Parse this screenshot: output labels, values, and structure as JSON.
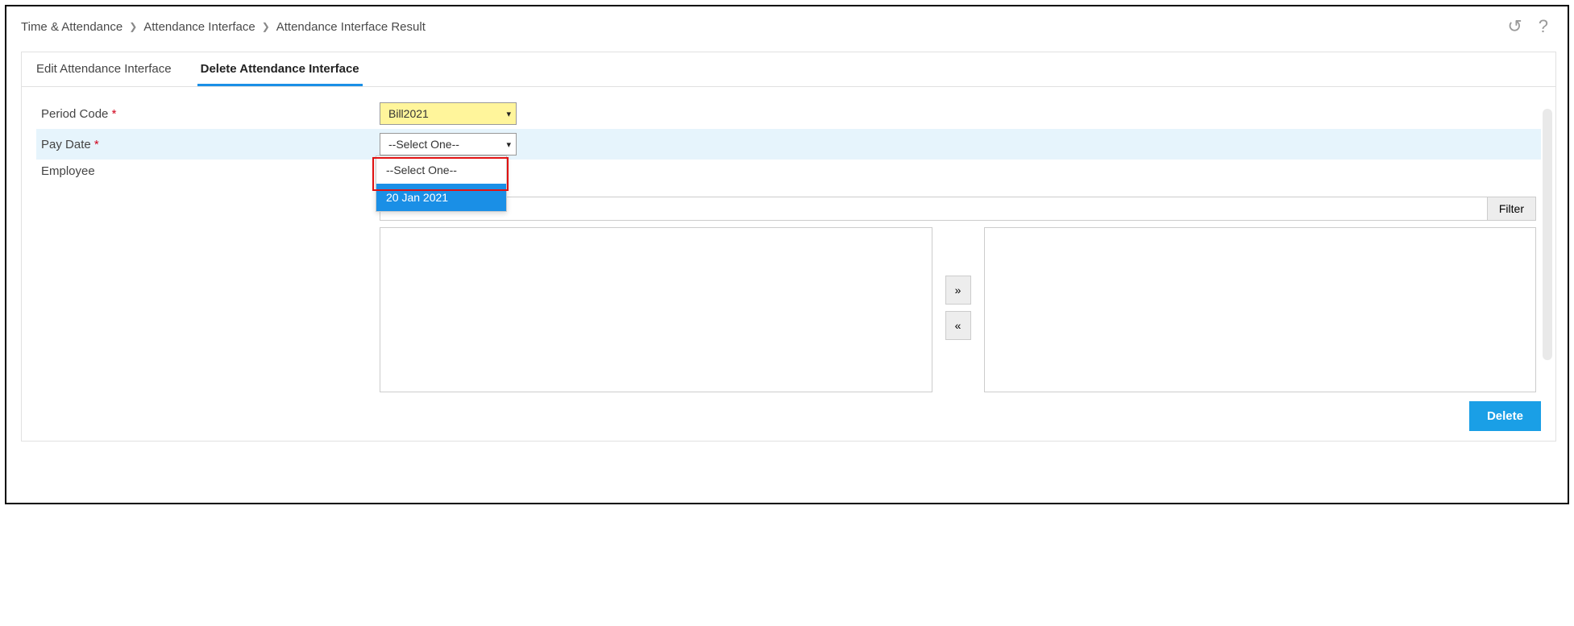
{
  "breadcrumbs": {
    "a": "Time & Attendance",
    "b": "Attendance Interface",
    "c": "Attendance Interface Result"
  },
  "tabs": {
    "edit": "Edit Attendance Interface",
    "delete": "Delete Attendance Interface"
  },
  "fields": {
    "period_code": {
      "label": "Period Code",
      "value": "Bill2021"
    },
    "pay_date": {
      "label": "Pay Date",
      "value": "--Select One--",
      "opt_placeholder": "--Select One--",
      "opt_1": "20 Jan 2021"
    },
    "employee": {
      "label": "Employee"
    }
  },
  "buttons": {
    "filter": "Filter",
    "move_right": "»",
    "move_left": "«",
    "delete": "Delete"
  },
  "icons": {
    "refresh": "↺",
    "help": "?"
  }
}
